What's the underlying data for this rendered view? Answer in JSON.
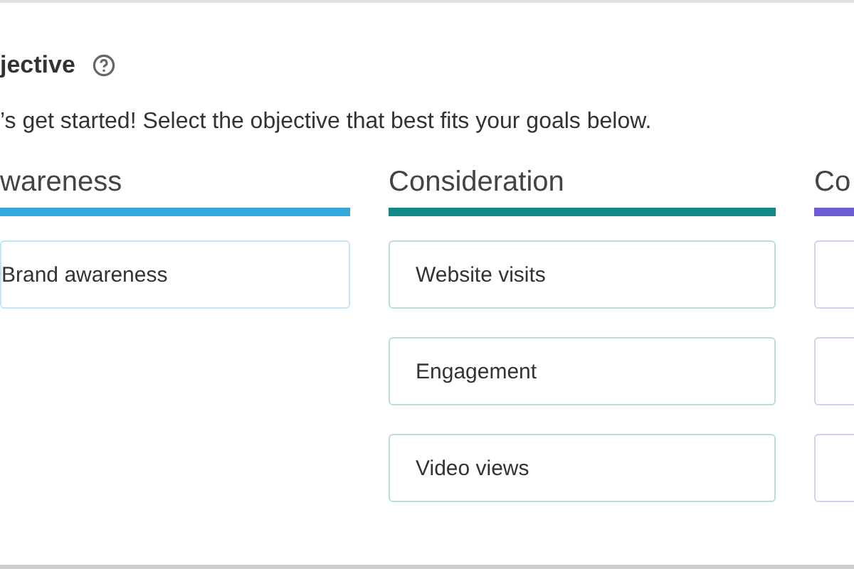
{
  "heading": {
    "title": "jective"
  },
  "description": "’s get started! Select the objective that best fits your goals below.",
  "columns": [
    {
      "title": "wareness",
      "color": "#33a8dc",
      "objectives": [
        {
          "kind": "text",
          "label": "Brand awareness"
        }
      ]
    },
    {
      "title": "Consideration",
      "color": "#138a8a",
      "objectives": [
        {
          "kind": "text",
          "label": "Website visits"
        },
        {
          "kind": "text",
          "label": "Engagement"
        },
        {
          "kind": "text",
          "label": "Video views"
        }
      ]
    },
    {
      "title": "Co",
      "color": "#6e5ed6",
      "objectives": [
        {
          "kind": "blank"
        },
        {
          "kind": "blank"
        },
        {
          "kind": "blank"
        }
      ]
    }
  ]
}
